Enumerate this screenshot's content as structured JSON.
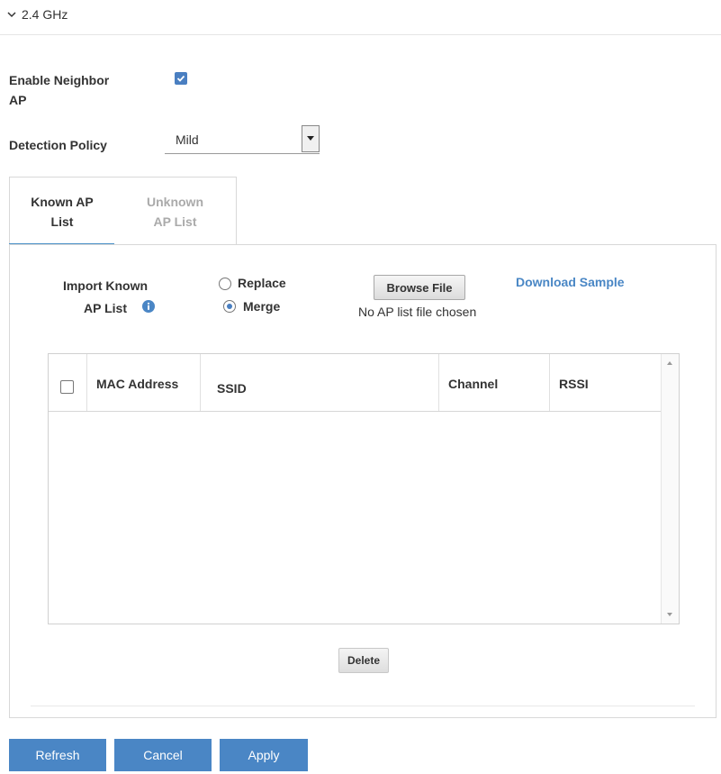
{
  "section": {
    "title": "2.4 GHz"
  },
  "neighbor_ap": {
    "label": "Enable Neighbor AP",
    "enabled": true
  },
  "detection_policy": {
    "label": "Detection Policy",
    "value": "Mild"
  },
  "tabs": [
    {
      "label": "Known AP List",
      "active": true
    },
    {
      "label": "Unknown AP List",
      "active": false
    }
  ],
  "import": {
    "label": "Import Known AP List",
    "info_icon": "info-icon",
    "options": [
      {
        "label": "Replace",
        "selected": false
      },
      {
        "label": "Merge",
        "selected": true
      }
    ],
    "browse_label": "Browse File",
    "file_status": "No AP list file chosen",
    "download_label": "Download Sample"
  },
  "table": {
    "columns": [
      "MAC Address",
      "SSID",
      "Channel",
      "RSSI"
    ],
    "rows": []
  },
  "delete_label": "Delete",
  "actions": {
    "refresh": "Refresh",
    "cancel": "Cancel",
    "apply": "Apply"
  },
  "colors": {
    "accent": "#4a86c5",
    "link": "#4a87c5",
    "tab_underline": "#4a90c8"
  }
}
